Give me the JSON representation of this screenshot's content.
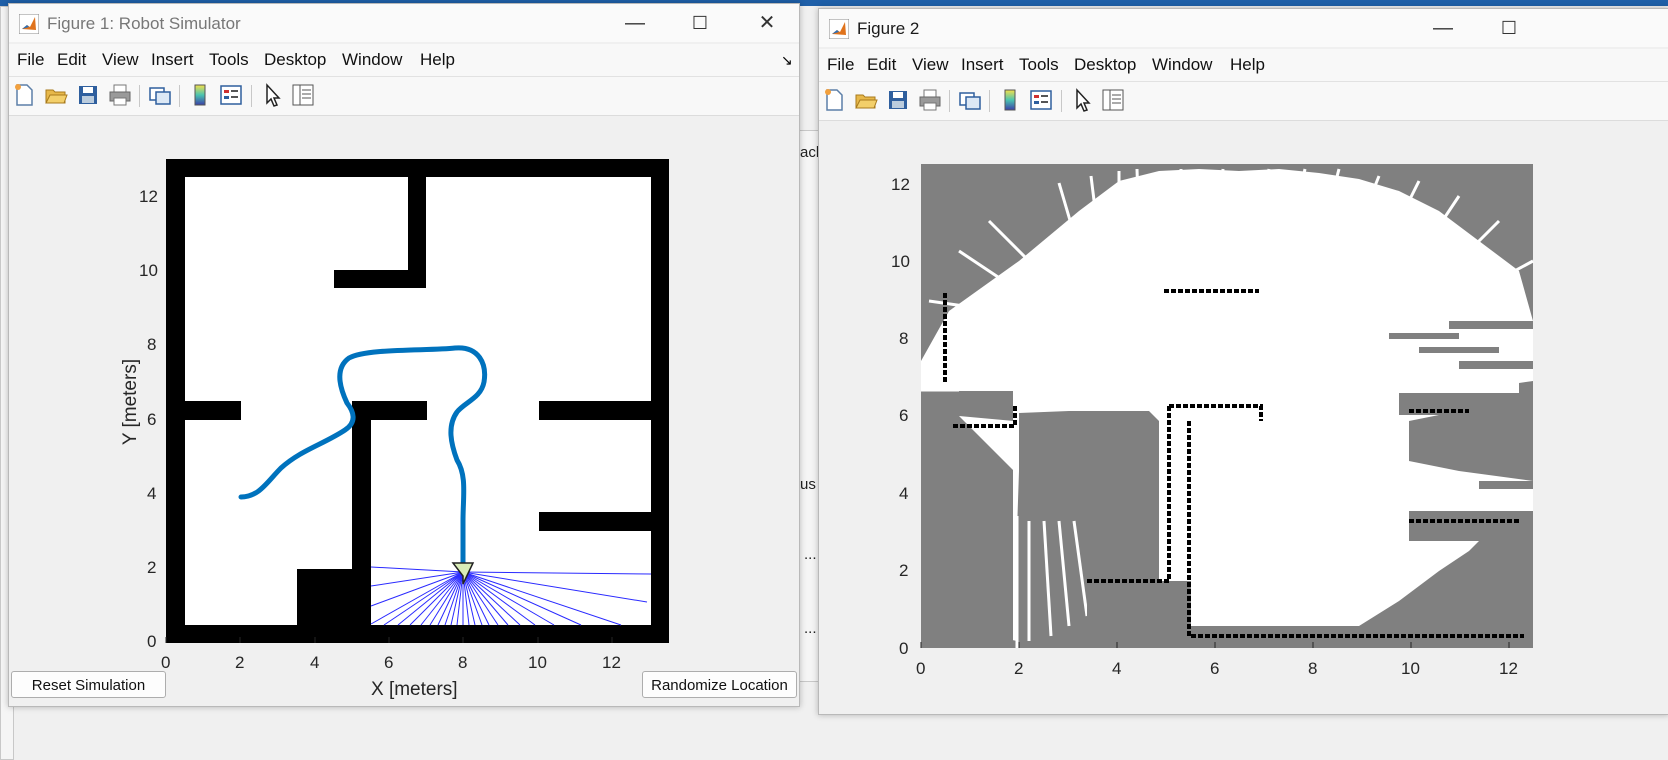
{
  "figure1": {
    "title": "Figure 1: Robot Simulator",
    "menus": [
      "File",
      "Edit",
      "View",
      "Insert",
      "Tools",
      "Desktop",
      "Window",
      "Help"
    ],
    "x_label": "X [meters]",
    "y_label": "Y [meters]",
    "x_ticks": [
      "0",
      "2",
      "4",
      "6",
      "8",
      "10",
      "12"
    ],
    "y_ticks": [
      "0",
      "2",
      "4",
      "6",
      "8",
      "10",
      "12"
    ],
    "reset_button": "Reset Simulation",
    "randomize_button": "Randomize Location",
    "path_color": "#0072bd",
    "scan_color": "#2222ff",
    "robot_color": "#d9ecb7"
  },
  "figure2": {
    "title": "Figure 2",
    "menus": [
      "File",
      "Edit",
      "View",
      "Insert",
      "Tools",
      "Desktop",
      "Window",
      "Help"
    ],
    "x_ticks": [
      "0",
      "2",
      "4",
      "6",
      "8",
      "10",
      "12"
    ],
    "y_ticks": [
      "0",
      "2",
      "4",
      "6",
      "8",
      "10",
      "12"
    ],
    "unknown_color": "#808080",
    "free_color": "#ffffff",
    "occupied_color": "#000000"
  },
  "toolbar_icons": [
    "new-figure-icon",
    "open-file-icon",
    "save-icon",
    "print-icon",
    "link-plot-icon",
    "insert-colorbar-icon",
    "insert-legend-icon",
    "edit-plot-icon",
    "property-inspector-icon"
  ],
  "background_fragments": {
    "obstacle_text": "acle",
    "status_text": "us",
    "ellipsis_1": "...",
    "ellipsis_2": "..."
  }
}
